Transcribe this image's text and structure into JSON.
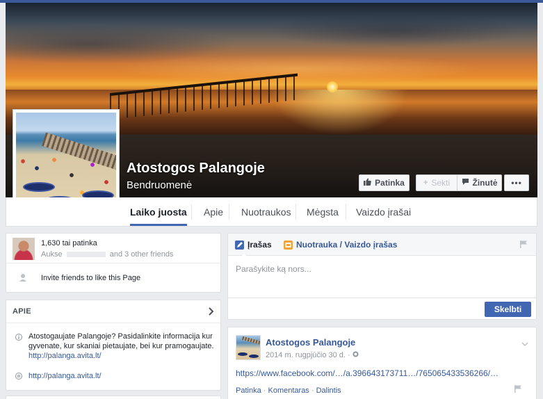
{
  "page": {
    "name": "Atostogos Palangoje",
    "category": "Bendruomenė"
  },
  "actions": {
    "like": "Patinka",
    "follow": "Sekti",
    "message": "Žinutė",
    "more": "•••"
  },
  "tabs": [
    {
      "label": "Laiko juosta",
      "active": true
    },
    {
      "label": "Apie"
    },
    {
      "label": "Nuotraukos"
    },
    {
      "label": "Mėgsta"
    },
    {
      "label": "Vaizdo įrašai"
    }
  ],
  "likes_card": {
    "count_text": "1,630 tai patinka",
    "friends_prefix": "Aukse",
    "friends_suffix": "and 3 other friends",
    "invite_text": "Invite friends to like this Page"
  },
  "about_card": {
    "header": "APIE",
    "description": "Atostogaujate Palangoje? Pasidalinkite informacija kur gyvenate, kur skaniai pietaujate, bei kur pramogaujate.",
    "description_link": "http://palanga.avita.lt/",
    "website": "http://palanga.avita.lt/"
  },
  "composer": {
    "tab_status": "Įrašas",
    "tab_photo": "Nuotrauka / Vaizdo įrašas",
    "placeholder": "Parašykite ką nors...",
    "post_button": "Skelbti"
  },
  "post": {
    "author": "Atostogos Palangoje",
    "date": "2014 m. rugpjūčio 30 d.",
    "link_text": "https://www.facebook.com/…/a.396643173711…/765065433536266/…",
    "actions": [
      "Patinka",
      "Komentaras",
      "Dalintis"
    ],
    "separator": "·"
  },
  "colors": {
    "brand": "#3b5998",
    "link": "#365899",
    "button_primary": "#4267b2"
  }
}
